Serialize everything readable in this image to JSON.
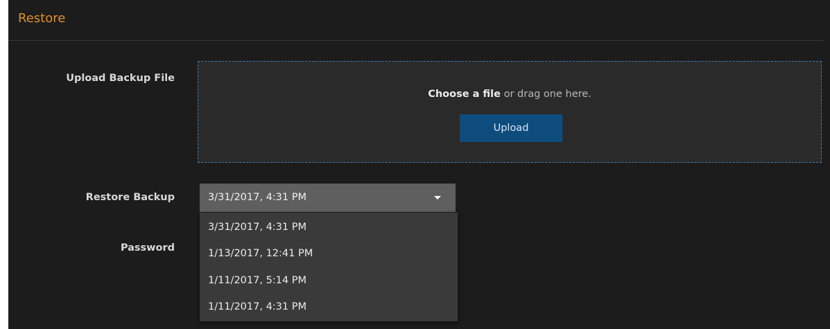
{
  "panel": {
    "title": "Restore"
  },
  "upload": {
    "label": "Upload Backup File",
    "choose_text": "Choose a file",
    "drag_text": " or drag one here.",
    "button_label": "Upload"
  },
  "restore": {
    "label": "Restore Backup",
    "selected": "3/31/2017, 4:31 PM",
    "options": [
      "3/31/2017, 4:31 PM",
      "1/13/2017, 12:41 PM",
      "1/11/2017, 5:14 PM",
      "1/11/2017, 4:31 PM"
    ]
  },
  "password": {
    "label": "Password"
  },
  "colors": {
    "accent_title": "#e0902e",
    "upload_button": "#0f4c7e",
    "dropzone_border": "#3f7fb8",
    "panel_background": "#1c1c1c"
  }
}
